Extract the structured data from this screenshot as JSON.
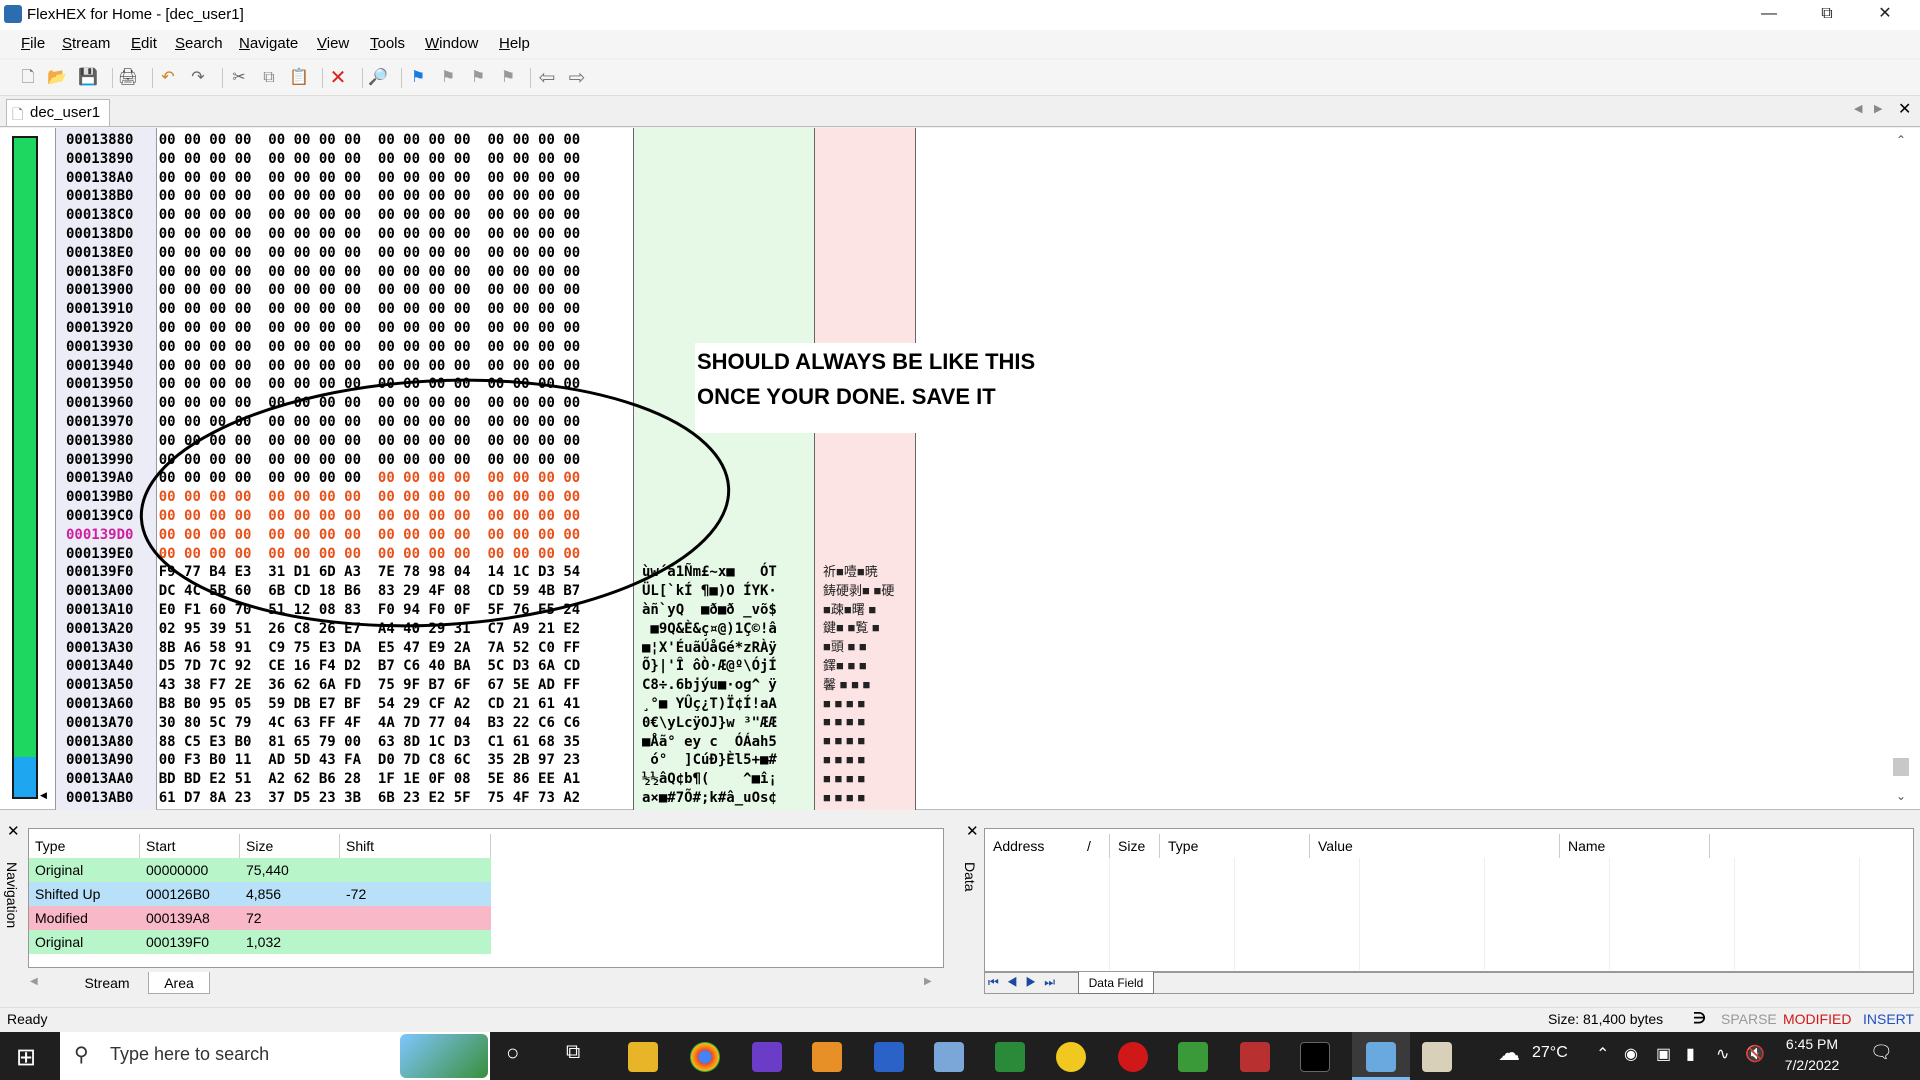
{
  "window": {
    "title": "FlexHEX for Home - [dec_user1]"
  },
  "menu": [
    "File",
    "Stream",
    "Edit",
    "Search",
    "Navigate",
    "View",
    "Tools",
    "Window",
    "Help"
  ],
  "document_tab": "dec_user1",
  "hex_rows": [
    {
      "addr": "00013880",
      "a": "00 00 00 00  00 00 00 00",
      "b": "00 00 00 00  00 00 00 00"
    },
    {
      "addr": "00013890",
      "a": "00 00 00 00  00 00 00 00",
      "b": "00 00 00 00  00 00 00 00"
    },
    {
      "addr": "000138A0",
      "a": "00 00 00 00  00 00 00 00",
      "b": "00 00 00 00  00 00 00 00"
    },
    {
      "addr": "000138B0",
      "a": "00 00 00 00  00 00 00 00",
      "b": "00 00 00 00  00 00 00 00"
    },
    {
      "addr": "000138C0",
      "a": "00 00 00 00  00 00 00 00",
      "b": "00 00 00 00  00 00 00 00"
    },
    {
      "addr": "000138D0",
      "a": "00 00 00 00  00 00 00 00",
      "b": "00 00 00 00  00 00 00 00"
    },
    {
      "addr": "000138E0",
      "a": "00 00 00 00  00 00 00 00",
      "b": "00 00 00 00  00 00 00 00"
    },
    {
      "addr": "000138F0",
      "a": "00 00 00 00  00 00 00 00",
      "b": "00 00 00 00  00 00 00 00"
    },
    {
      "addr": "00013900",
      "a": "00 00 00 00  00 00 00 00",
      "b": "00 00 00 00  00 00 00 00"
    },
    {
      "addr": "00013910",
      "a": "00 00 00 00  00 00 00 00",
      "b": "00 00 00 00  00 00 00 00"
    },
    {
      "addr": "00013920",
      "a": "00 00 00 00  00 00 00 00",
      "b": "00 00 00 00  00 00 00 00"
    },
    {
      "addr": "00013930",
      "a": "00 00 00 00  00 00 00 00",
      "b": "00 00 00 00  00 00 00 00"
    },
    {
      "addr": "00013940",
      "a": "00 00 00 00  00 00 00 00",
      "b": "00 00 00 00  00 00 00 00"
    },
    {
      "addr": "00013950",
      "a": "00 00 00 00  00 00 00 00",
      "b": "00 00 00 00  00 00 00 00"
    },
    {
      "addr": "00013960",
      "a": "00 00 00 00  00 00 00 00",
      "b": "00 00 00 00  00 00 00 00"
    },
    {
      "addr": "00013970",
      "a": "00 00 00 00  00 00 00 00",
      "b": "00 00 00 00  00 00 00 00"
    },
    {
      "addr": "00013980",
      "a": "00 00 00 00  00 00 00 00",
      "b": "00 00 00 00  00 00 00 00"
    },
    {
      "addr": "00013990",
      "a": "00 00 00 00  00 00 00 00",
      "b": "00 00 00 00  00 00 00 00"
    },
    {
      "addr": "000139A0",
      "a": "00 00 00 00  00 00 00 00",
      "b": "00 00 00 00  00 00 00 00",
      "red_b": true
    },
    {
      "addr": "000139B0",
      "a": "00 00 00 00  00 00 00 00",
      "b": "00 00 00 00  00 00 00 00",
      "red_a": true,
      "red_b": true
    },
    {
      "addr": "000139C0",
      "a": "00 00 00 00  00 00 00 00",
      "b": "00 00 00 00  00 00 00 00",
      "red_a": true,
      "red_b": true
    },
    {
      "addr": "000139D0",
      "a": "00 00 00 00  00 00 00 00",
      "b": "00 00 00 00  00 00 00 00",
      "red_a": true,
      "red_b": true,
      "current": true
    },
    {
      "addr": "000139E0",
      "a": "00 00 00 00  00 00 00 00",
      "b": "00 00 00 00  00 00 00 00",
      "red_a": true,
      "red_b": true
    },
    {
      "addr": "000139F0",
      "a": "F9 77 B4 E3  31 D1 6D A3",
      "b": "7E 78 98 04  14 1C D3 54",
      "asc": "ùw´ã1Ñm£~x■   ÓT"
    },
    {
      "addr": "00013A00",
      "a": "DC 4C 5B 60  6B CD 18 B6",
      "b": "83 29 4F 08  CD 59 4B B7",
      "asc": "ÜL[`kÍ ¶■)O ÍYK·"
    },
    {
      "addr": "00013A10",
      "a": "E0 F1 60 70  51 12 08 83",
      "b": "F0 94 F0 0F  5F 76 F5 24",
      "asc": "àñ`yQ  ■ð■ð _võ$"
    },
    {
      "addr": "00013A20",
      "a": "02 95 39 51  26 C8 26 E7",
      "b": "A4 40 29 31  C7 A9 21 E2",
      "asc": " ■9Q&È&ç¤@)1Ç©!â"
    },
    {
      "addr": "00013A30",
      "a": "8B A6 58 91  C9 75 E3 DA",
      "b": "E5 47 E9 2A  7A 52 C0 FF",
      "asc": "■¦X'ÉuãÚåGé*zRÀÿ"
    },
    {
      "addr": "00013A40",
      "a": "D5 7D 7C 92  CE 16 F4 D2",
      "b": "B7 C6 40 BA  5C D3 6A CD",
      "asc": "Õ}|'Î ôÒ·Æ@º\\ÓjÍ"
    },
    {
      "addr": "00013A50",
      "a": "43 38 F7 2E  36 62 6A FD",
      "b": "75 9F B7 6F  67 5E AD FF",
      "asc": "C8÷.6bjýu■·og^ ÿ"
    },
    {
      "addr": "00013A60",
      "a": "B8 B0 95 05  59 DB E7 BF",
      "b": "54 29 CF A2  CD 21 61 41",
      "asc": "¸°■ YÛç¿T)Ï¢Í!aA"
    },
    {
      "addr": "00013A70",
      "a": "30 80 5C 79  4C 63 FF 4F",
      "b": "4A 7D 77 04  B3 22 C6 C6",
      "asc": "0€\\yLcÿOJ}w ³\"ÆÆ"
    },
    {
      "addr": "00013A80",
      "a": "88 C5 E3 B0  81 65 79 00",
      "b": "63 8D 1C D3  C1 61 68 35",
      "asc": "■Åã° ey c  ÓÁah5"
    },
    {
      "addr": "00013A90",
      "a": "00 F3 B0 11  AD 5D 43 FA",
      "b": "D0 7D C8 6C  35 2B 97 23",
      "asc": " ó°  ]CúÐ}Èl5+■#"
    },
    {
      "addr": "00013AA0",
      "a": "BD BD E2 51  A2 62 B6 28",
      "b": "1F 1E 0F 08  5E 86 EE A1",
      "asc": "½½âQ¢b¶(    ^■î¡"
    },
    {
      "addr": "00013AB0",
      "a": "61 D7 8A 23  37 D5 23 3B",
      "b": "6B 23 E2 5F  75 4F 73 A2",
      "asc": "a×■#7Õ#;k#â_uOs¢"
    }
  ],
  "dbcs_text": [
    "祈■噎■暁",
    "鋳硬剥■ ■硬",
    "■疎■曙 ■",
    "鍵■ ■覧 ■",
    "■頭 ■ ■",
    "鐸■ ■ ■",
    "馨 ■ ■ ■",
    "■ ■ ■ ■",
    "■ ■ ■ ■",
    "■ ■ ■ ■",
    "■ ■ ■ ■",
    "■ ■ ■ ■",
    "■ ■ ■ ■"
  ],
  "annotation": {
    "line1": "SHOULD ALWAYS BE LIKE THIS",
    "line2": "ONCE YOUR DONE. SAVE IT"
  },
  "navigation": {
    "label": "Navigation",
    "headers": [
      "Type",
      "Start",
      "Size",
      "Shift"
    ],
    "rows": [
      {
        "type": "Original",
        "start": "00000000",
        "size": "75,440",
        "shift": "",
        "color": "#b8f5c8"
      },
      {
        "type": "Shifted Up",
        "start": "000126B0",
        "size": "4,856",
        "shift": "-72",
        "color": "#b8e0f8"
      },
      {
        "type": "Modified",
        "start": "000139A8",
        "size": "72",
        "shift": "",
        "color": "#f8b8c8"
      },
      {
        "type": "Original",
        "start": "000139F0",
        "size": "1,032",
        "shift": "",
        "color": "#b8f5c8"
      }
    ],
    "tabs": [
      "Stream",
      "Area"
    ]
  },
  "data_panel": {
    "label": "Data",
    "headers": [
      "Address",
      "Size",
      "Type",
      "Value",
      "Name"
    ],
    "tab": "Data Field"
  },
  "status": {
    "left": "Ready",
    "size": "Size: 81,400 bytes",
    "sparse": "SPARSE",
    "modified": "MODIFIED",
    "insert": "INSERT"
  },
  "taskbar": {
    "search_placeholder": "Type here to search",
    "temperature": "27°C",
    "time": "6:45 PM",
    "date": "7/2/2022"
  }
}
